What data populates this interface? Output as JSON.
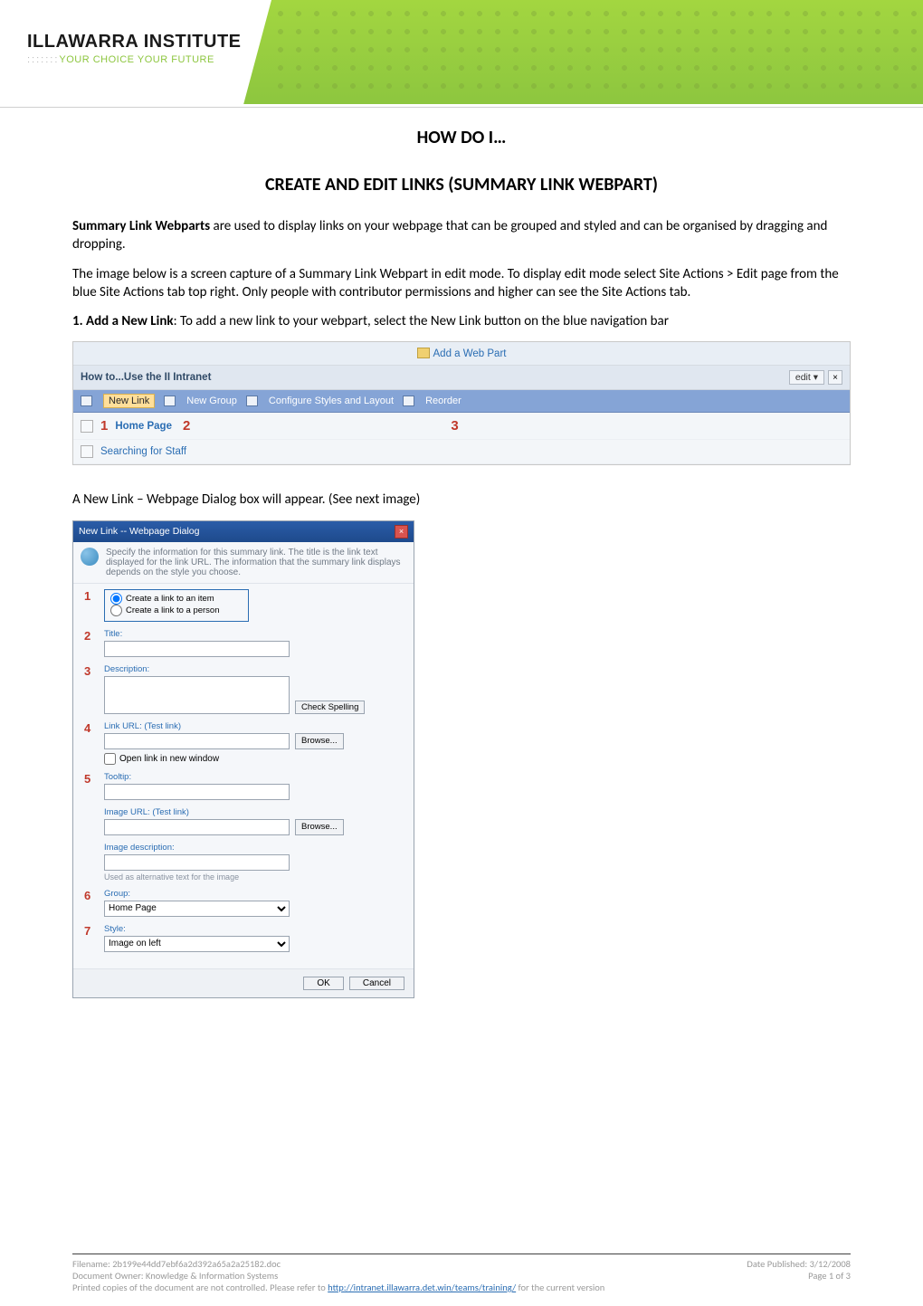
{
  "logo": {
    "main": "ILLAWARRA INSTITUTE",
    "sub_prefix_dots": "::::::: ",
    "sub": "YOUR CHOICE YOUR FUTURE"
  },
  "doc": {
    "heading1": "HOW DO I…",
    "heading2": "CREATE AND EDIT LINKS (SUMMARY LINK WEBPART)",
    "p1_bold": "Summary Link Webparts",
    "p1_rest": " are used to display links on your webpage that can be grouped and styled and can be organised by dragging and dropping.",
    "p2": "The image below is a screen capture of a Summary Link Webpart in edit mode.  To display edit mode select Site Actions > Edit page from the blue Site Actions tab top right.  Only people with contributor permissions and higher can see the Site Actions tab.",
    "p3_bold": "1. Add a New Link",
    "p3_rest": ": To add a new link to your webpart, select the New Link button on the blue navigation bar",
    "p4": "A New Link – Webpage Dialog box will appear. (See next image)"
  },
  "shot1": {
    "add_web_part": "Add a Web Part",
    "title": "How to...Use the II Intranet",
    "edit": "edit ▾",
    "close": "×",
    "tb_new_link": "New Link",
    "tb_new_group": "New Group",
    "tb_configure": "Configure Styles and Layout",
    "tb_reorder": "Reorder",
    "row1": "Home Page",
    "row2": "Searching for Staff",
    "m1": "1",
    "m2": "2",
    "m3": "3"
  },
  "shot2": {
    "title": "New Link -- Webpage Dialog",
    "close": "×",
    "desc": "Specify the information for this summary link. The title is the link text displayed for the link URL. The information that the summary link displays depends on the style you choose.",
    "radio_item": "Create a link to an item",
    "radio_person": "Create a link to a person",
    "lbl_title": "Title:",
    "lbl_description": "Description:",
    "btn_check_spelling": "Check Spelling",
    "lbl_link_url": "Link URL:  (Test link)",
    "btn_browse": "Browse...",
    "chk_open_new": "Open link in new window",
    "lbl_tooltip": "Tooltip:",
    "lbl_image_url": "Image URL:  (Test link)",
    "lbl_image_desc": "Image description:",
    "help_image_desc": "Used as alternative text for the image",
    "lbl_group": "Group:",
    "val_group": "Home Page",
    "lbl_style": "Style:",
    "val_style": "Image on left",
    "btn_ok": "OK",
    "btn_cancel": "Cancel",
    "m1": "1",
    "m2": "2",
    "m3": "3",
    "m4": "4",
    "m5": "5",
    "m6": "6",
    "m7": "7"
  },
  "footer": {
    "filename_label": "Filename: ",
    "filename": "2b199e44dd7ebf6a2d392a65a2a25182.doc",
    "date_label": "Date Published: ",
    "date": "3/12/2008",
    "owner_label": "Document Owner: ",
    "owner": "Knowledge & Information Systems",
    "page": "Page 1 of 3",
    "printed_pre": "Printed copies of the document are not controlled. Please refer to ",
    "url": "http://intranet.illawarra.det.win/teams/training/",
    "printed_post": " for the current version"
  }
}
